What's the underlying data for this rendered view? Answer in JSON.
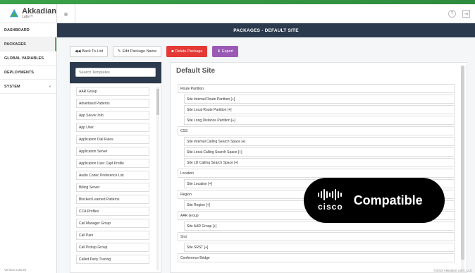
{
  "brand": {
    "name": "Akkadian",
    "sub": "Labs™"
  },
  "sidebar": {
    "items": [
      {
        "label": "DASHBOARD",
        "chevron": ""
      },
      {
        "label": "PACKAGES",
        "chevron": ""
      },
      {
        "label": "GLOBAL VARIABLES",
        "chevron": ""
      },
      {
        "label": "DEPLOYMENTS",
        "chevron": ""
      },
      {
        "label": "SYSTEM",
        "chevron": "‹"
      }
    ],
    "active": "PACKAGES",
    "accent": "#4caf50"
  },
  "version": "Version 8.26.20",
  "page": {
    "title": "PACKAGES - DEFAULT SITE"
  },
  "toolbar": {
    "back": "Back To List",
    "edit": "Edit Package Name",
    "delete": "Delete Package",
    "export": "Export"
  },
  "search": {
    "placeholder": "Search Templates",
    "value": ""
  },
  "templates": [
    "AAR Group",
    "Advertised Patterns",
    "App Server Info",
    "App User",
    "Application Dial Rules",
    "Application Server",
    "Application User Capf Profile",
    "Audio Codec Preference List",
    "Billing Server",
    "Blocked Learned Patterns",
    "CCA Profiles",
    "Call Manager Group",
    "Call Park",
    "Call Pickup Group",
    "Called Party Tracing"
  ],
  "site": {
    "title": "Default Site",
    "tree": [
      {
        "label": "Route Partition",
        "child": false
      },
      {
        "label": "Site Internal Route Partition  [+]",
        "child": true
      },
      {
        "label": "Site Local Route Partition  [+]",
        "child": true
      },
      {
        "label": "Site Long Distance Partition  [+]",
        "child": true
      },
      {
        "label": "CSS",
        "child": false
      },
      {
        "label": "Site Internal Calling Search Space  [+]",
        "child": true
      },
      {
        "label": "Site Local Calling Search Space  [+]",
        "child": true
      },
      {
        "label": "Site LD Calling Search Space  [+]",
        "child": true
      },
      {
        "label": "Location",
        "child": false
      },
      {
        "label": "Site Location  [+]",
        "child": true
      },
      {
        "label": "Region",
        "child": false
      },
      {
        "label": "Site Region  [+]",
        "child": true
      },
      {
        "label": "AAR Group",
        "child": false
      },
      {
        "label": "Site AAR Group  [+]",
        "child": true
      },
      {
        "label": "Srst",
        "child": false
      },
      {
        "label": "Site SRST  [+]",
        "child": true
      },
      {
        "label": "Conference Bridge",
        "child": false
      }
    ]
  },
  "copyright": "©2018 Akkadian Labs, LLC",
  "badge": {
    "logo": "cisco",
    "text": "Compatible"
  },
  "icons": {
    "menu": "hamburger-icon",
    "help": "help-icon",
    "logout": "logout-icon"
  }
}
